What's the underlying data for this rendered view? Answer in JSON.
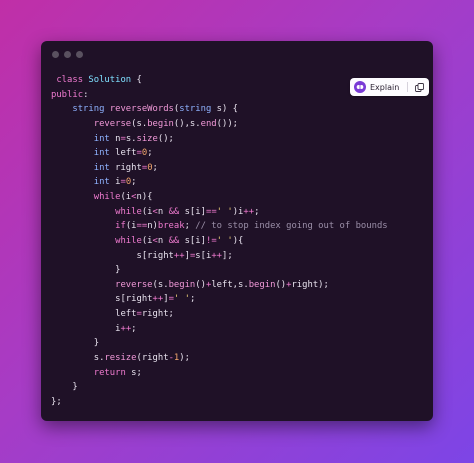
{
  "window": {
    "controls": [
      "close",
      "minimize",
      "maximize"
    ]
  },
  "toolbar": {
    "explain_label": "Explain",
    "explain_icon": "brain-icon",
    "copy_icon": "copy-icon"
  },
  "code": {
    "language": "cpp",
    "lines": [
      " class Solution {",
      "public:",
      "    string reverseWords(string s) {",
      "        reverse(s.begin(),s.end());",
      "        int n=s.size();",
      "        int left=0;",
      "        int right=0;",
      "        int i=0;",
      "        while(i<n){",
      "            while(i<n && s[i]==' ')i++;",
      "            if(i==n)break; // to stop index going out of bounds",
      "            while(i<n && s[i]!=' '){",
      "                s[right++]=s[i++];",
      "            }",
      "            reverse(s.begin()+left,s.begin()+right);",
      "            s[right++]=' ';",
      "            left=right;",
      "            i++;",
      "        }",
      "        s.resize(right-1);",
      "        return s;",
      "    }",
      "};"
    ]
  },
  "colors": {
    "background_start": "#c02fa7",
    "background_end": "#7d45e6",
    "editor_bg": "#1f1127",
    "keyword": "#f07bd0",
    "type": "#8fb2ff",
    "number": "#f0a56d",
    "string": "#f5d77a",
    "comment": "#9b8fa8"
  }
}
